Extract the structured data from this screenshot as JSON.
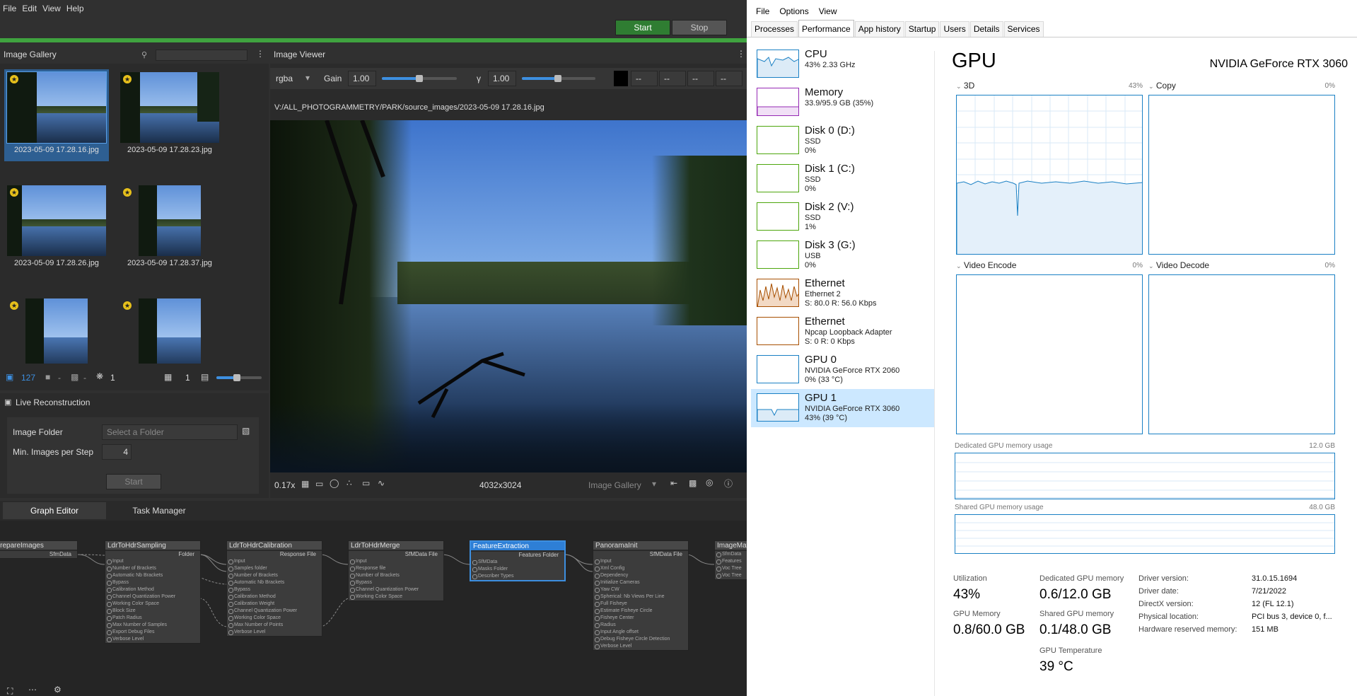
{
  "meshroom": {
    "menu": [
      "File",
      "Edit",
      "View",
      "Help"
    ],
    "start_label": "Start",
    "stop_label": "Stop",
    "gallery": {
      "title": "Image Gallery",
      "search_placeholder": "",
      "images": [
        {
          "name": "2023-05-09 17.28.16.jpg",
          "selected": true
        },
        {
          "name": "2023-05-09 17.28.23.jpg",
          "selected": false
        },
        {
          "name": "2023-05-09 17.28.26.jpg",
          "selected": false
        },
        {
          "name": "2023-05-09 17.28.37.jpg",
          "selected": false
        },
        {
          "name": "",
          "selected": false
        },
        {
          "name": "",
          "selected": false
        }
      ],
      "footer": {
        "image_count": "127",
        "cam_count": "-",
        "nocam_count": "-",
        "intrinsics_count": "1",
        "thumb_count": "1"
      }
    },
    "viewer": {
      "title": "Image Viewer",
      "channel": "rgba",
      "gain_label": "Gain",
      "gain_value": "1.00",
      "gamma_label": "γ",
      "gamma_value": "1.00",
      "pixel_values": [
        "--",
        "--",
        "--",
        "--"
      ],
      "path": "V:/ALL_PHOTOGRAMMETRY/PARK/source_images/2023-05-09 17.28.16.jpg",
      "zoom": "0.17x",
      "resolution": "4032x3024",
      "source": "Image Gallery"
    },
    "live": {
      "title": "Live Reconstruction",
      "folder_label": "Image Folder",
      "folder_placeholder": "Select a Folder",
      "min_label": "Min. Images per Step",
      "min_value": "4",
      "start_label": "Start"
    },
    "graph_tabs": [
      "Graph Editor",
      "Task Manager"
    ],
    "nodes": [
      {
        "title": "amaPrepareImages",
        "outputs": [
          "SfmData"
        ],
        "inputs": []
      },
      {
        "title": "LdrToHdrSampling",
        "outputs": [
          "Folder"
        ],
        "inputs": [
          "Input",
          "Number of Brackets",
          "Automatic Nb Brackets",
          "Bypass",
          "Calibration Method",
          "Channel Quantization Power",
          "Working Color Space",
          "Block Size",
          "Patch Radius",
          "Max Number of Samples",
          "Export Debug Files",
          "Verbose Level"
        ]
      },
      {
        "title": "LdrToHdrCalibration",
        "outputs": [
          "Response File"
        ],
        "inputs": [
          "Input",
          "Samples folder",
          "Number of Brackets",
          "Automatic Nb Brackets",
          "Bypass",
          "Calibration Method",
          "Calibration Weight",
          "Channel Quantization Power",
          "Working Color Space",
          "Max Number of Points",
          "Verbose Level"
        ]
      },
      {
        "title": "LdrToHdrMerge",
        "outputs": [
          "SfMData File"
        ],
        "inputs": [
          "Input",
          "Response file",
          "Number of Brackets",
          "Bypass",
          "Channel Quantization Power",
          "Working Color Space"
        ]
      },
      {
        "title": "FeatureExtraction",
        "outputs": [
          "Features Folder"
        ],
        "inputs": [
          "SfMData",
          "Masks Folder",
          "Describer Types"
        ]
      },
      {
        "title": "PanoramaInit",
        "outputs": [
          "SfMData File"
        ],
        "inputs": [
          "Input",
          "Xml Config",
          "Dependency",
          "Initialize Cameras",
          "Yaw CW",
          "Spherical: Nb Views Per Line",
          "Full Fisheye",
          "Estimate Fisheye Circle",
          "Fisheye Center",
          "Radius",
          "Input Angle offset",
          "Debug Fisheye Circle Detection",
          "Verbose Level"
        ]
      },
      {
        "title": "ImageMat",
        "outputs": [],
        "inputs": [
          "SfmData",
          "Features",
          "Voc Tree",
          "Voc Tree"
        ]
      }
    ]
  },
  "taskmanager": {
    "menu": [
      "File",
      "Options",
      "View"
    ],
    "tabs": [
      "Processes",
      "Performance",
      "App history",
      "Startup",
      "Users",
      "Details",
      "Services"
    ],
    "active_tab": "Performance",
    "resources": [
      {
        "name": "CPU",
        "line1": "43%  2.33 GHz",
        "line2": "",
        "line3": "",
        "color": "#1a80c4"
      },
      {
        "name": "Memory",
        "line1": "33.9/95.9 GB (35%)",
        "line2": "",
        "line3": "",
        "color": "#9528b4"
      },
      {
        "name": "Disk 0 (D:)",
        "line1": "SSD",
        "line2": "0%",
        "line3": "",
        "color": "#4da60c"
      },
      {
        "name": "Disk 1 (C:)",
        "line1": "SSD",
        "line2": "0%",
        "line3": "",
        "color": "#4da60c"
      },
      {
        "name": "Disk 2 (V:)",
        "line1": "SSD",
        "line2": "1%",
        "line3": "",
        "color": "#4da60c"
      },
      {
        "name": "Disk 3 (G:)",
        "line1": "USB",
        "line2": "0%",
        "line3": "",
        "color": "#4da60c"
      },
      {
        "name": "Ethernet",
        "line1": "Ethernet 2",
        "line2": "S: 80.0  R: 56.0 Kbps",
        "line3": "",
        "color": "#a74f01"
      },
      {
        "name": "Ethernet",
        "line1": "Npcap Loopback Adapter",
        "line2": "S: 0  R: 0 Kbps",
        "line3": "",
        "color": "#a74f01"
      },
      {
        "name": "GPU 0",
        "line1": "NVIDIA GeForce RTX 2060",
        "line2": "0%  (33 °C)",
        "line3": "",
        "color": "#1a80c4"
      },
      {
        "name": "GPU 1",
        "line1": "NVIDIA GeForce RTX 3060",
        "line2": "43%  (39 °C)",
        "line3": "",
        "color": "#1a80c4"
      }
    ],
    "gpu": {
      "title": "GPU",
      "model": "NVIDIA GeForce RTX 3060",
      "graphs": [
        {
          "label": "3D",
          "pct": "43%"
        },
        {
          "label": "Copy",
          "pct": "0%"
        },
        {
          "label": "Video Encode",
          "pct": "0%"
        },
        {
          "label": "Video Decode",
          "pct": "0%"
        }
      ],
      "dedicated_label": "Dedicated GPU memory usage",
      "dedicated_max": "12.0 GB",
      "shared_label": "Shared GPU memory usage",
      "shared_max": "48.0 GB",
      "stats": {
        "utilization_label": "Utilization",
        "utilization": "43%",
        "gpu_memory_label": "GPU Memory",
        "gpu_memory": "0.8/60.0 GB",
        "dedicated_label": "Dedicated GPU memory",
        "dedicated": "0.6/12.0 GB",
        "shared_label": "Shared GPU memory",
        "shared": "0.1/48.0 GB",
        "temp_label": "GPU Temperature",
        "temp": "39 °C"
      },
      "info": [
        {
          "label": "Driver version:",
          "value": "31.0.15.1694"
        },
        {
          "label": "Driver date:",
          "value": "7/21/2022"
        },
        {
          "label": "DirectX version:",
          "value": "12 (FL 12.1)"
        },
        {
          "label": "Physical location:",
          "value": "PCI bus 3, device 0, f..."
        },
        {
          "label": "Hardware reserved memory:",
          "value": "151 MB"
        }
      ]
    }
  }
}
